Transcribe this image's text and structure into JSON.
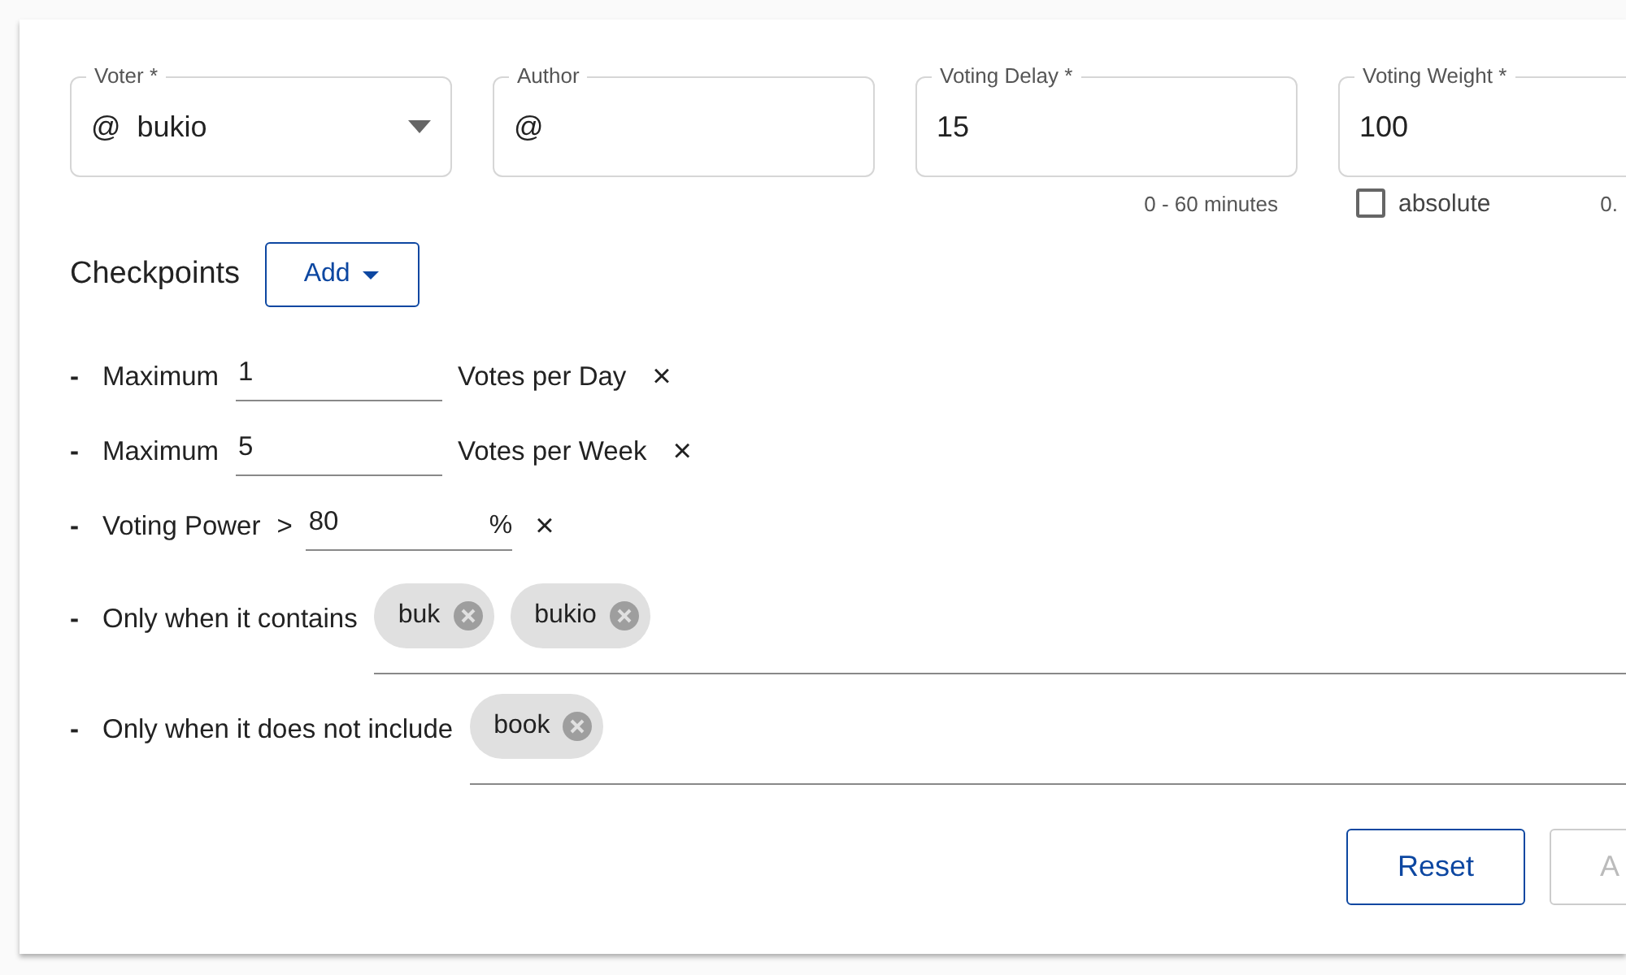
{
  "fields": [
    {
      "label": "Voter *",
      "prefix": "@",
      "value": "bukio",
      "kind": "select"
    },
    {
      "label": "Author",
      "prefix": "@",
      "kind": "text"
    },
    {
      "label": "Voting Delay *",
      "value": "15",
      "kind": "text",
      "hint": "0 - 60 minutes"
    },
    {
      "label": "Voting Weight *",
      "value": "100",
      "kind": "text",
      "checkbox": {
        "label": "absolute",
        "checked": false
      },
      "hint": "0."
    }
  ],
  "checkpoints": {
    "title": "Checkpoints",
    "add_button": "Add"
  },
  "rules": [
    {
      "kind": "limit",
      "bullet": "-",
      "label": "Maximum",
      "value": "1",
      "unit": "Votes per Day",
      "remove": "×"
    },
    {
      "kind": "limit",
      "bullet": "-",
      "label": "Maximum",
      "value": "5",
      "unit": "Votes per Week",
      "remove": "×"
    },
    {
      "kind": "power",
      "bullet": "-",
      "label": "Voting Power",
      "operator": ">",
      "value": "80",
      "unit": "%",
      "remove": "×"
    },
    {
      "kind": "tags",
      "bullet": "-",
      "label": "Only when it contains",
      "tags": [
        "buk",
        "bukio"
      ]
    },
    {
      "kind": "tags",
      "bullet": "-",
      "label": "Only when it does not include",
      "tags": [
        "book"
      ]
    }
  ],
  "buttons": [
    {
      "label": "Reset",
      "disabled": false
    },
    {
      "label": "A",
      "disabled": true
    }
  ]
}
